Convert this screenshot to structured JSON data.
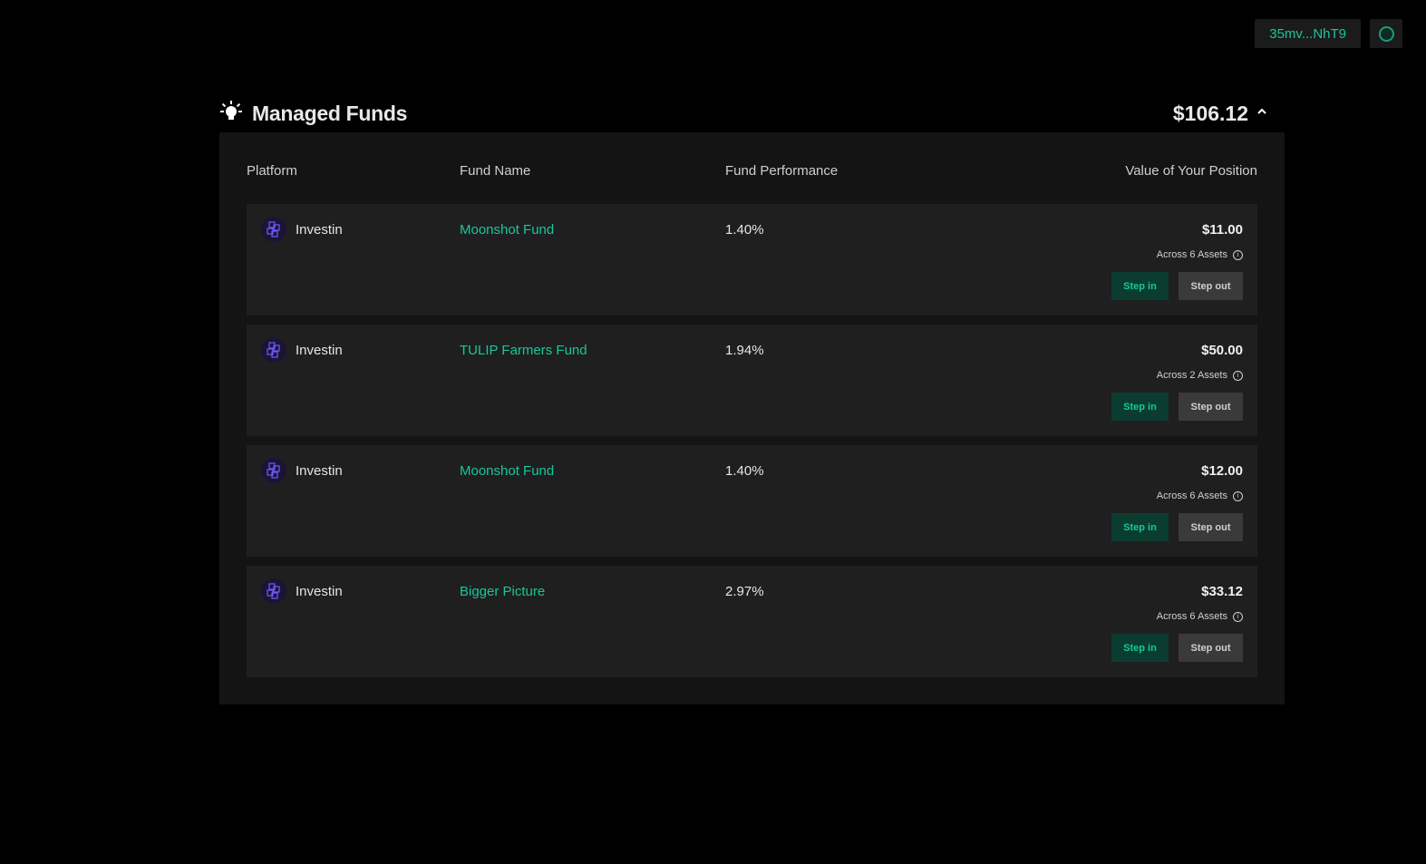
{
  "header": {
    "wallet_address": "35mv...NhT9",
    "avatar_icon": "avatar-ring-icon"
  },
  "section": {
    "icon": "lightbulb-icon",
    "title": "Managed Funds",
    "total": "$106.12",
    "toggle_icon": "chevron-up-icon"
  },
  "table": {
    "columns": {
      "platform": "Platform",
      "fund_name": "Fund Name",
      "performance": "Fund Performance",
      "value": "Value of Your Position"
    },
    "rows": [
      {
        "platform": "Investin",
        "fund_name": "Moonshot Fund",
        "performance": "1.40%",
        "value": "$11.00",
        "assets": "Across 6 Assets",
        "step_in": "Step in",
        "step_out": "Step out"
      },
      {
        "platform": "Investin",
        "fund_name": "TULIP Farmers Fund",
        "performance": "1.94%",
        "value": "$50.00",
        "assets": "Across 2 Assets",
        "step_in": "Step in",
        "step_out": "Step out"
      },
      {
        "platform": "Investin",
        "fund_name": "Moonshot Fund",
        "performance": "1.40%",
        "value": "$12.00",
        "assets": "Across 6 Assets",
        "step_in": "Step in",
        "step_out": "Step out"
      },
      {
        "platform": "Investin",
        "fund_name": "Bigger Picture",
        "performance": "2.97%",
        "value": "$33.12",
        "assets": "Across 6 Assets",
        "step_in": "Step in",
        "step_out": "Step out"
      }
    ]
  },
  "colors": {
    "accent": "#18c79a",
    "background": "#000000",
    "panel": "#141414",
    "row": "#1f1f1f",
    "step_in_bg": "#0a3d30",
    "step_out_bg": "#3a3a3a"
  }
}
